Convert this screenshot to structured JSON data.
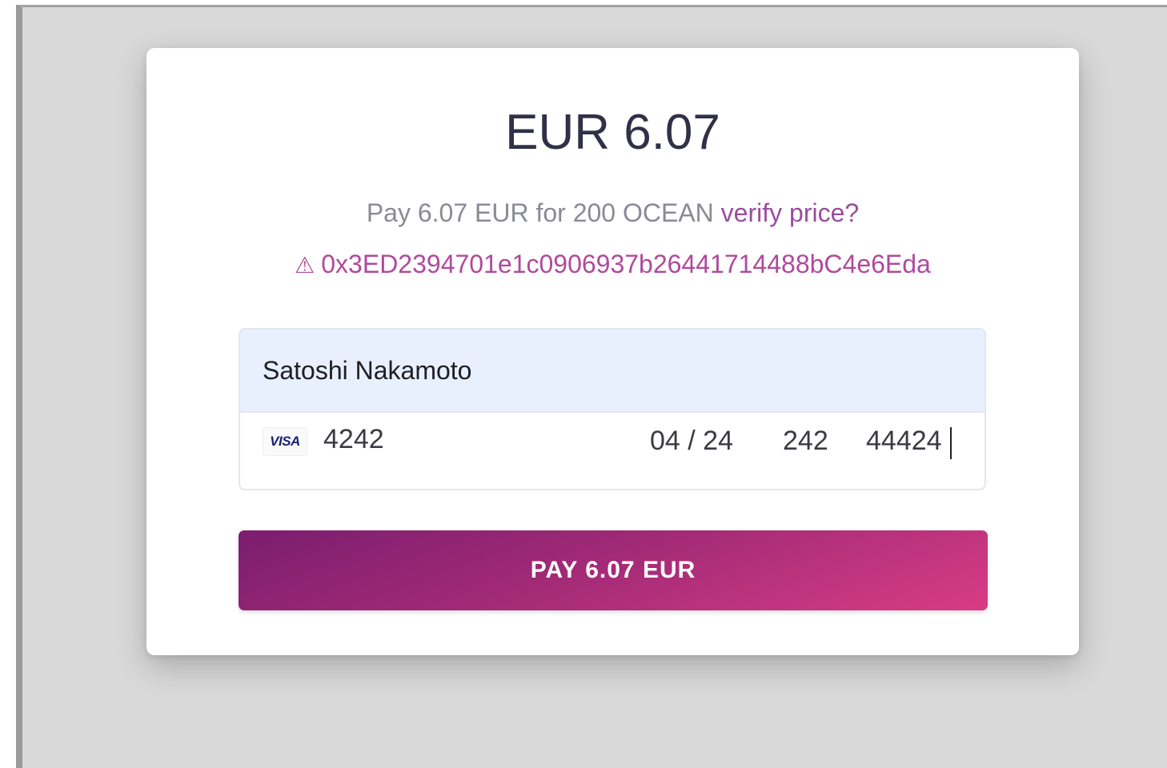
{
  "checkout": {
    "amount_display": "EUR 6.07",
    "pay_text": "Pay 6.07 EUR for 200 OCEAN",
    "verify_link": "verify price?",
    "warning_glyph": "⚠",
    "address": "0x3ED2394701e1c0906937b26441714488bC4e6Eda"
  },
  "card_form": {
    "name_value": "Satoshi Nakamoto",
    "brand_label": "VISA",
    "card_number_value": "4242",
    "expiry_value": "04 / 24",
    "cvc_value": "242",
    "zip_value": "44424"
  },
  "pay_button": {
    "label": "PAY 6.07 EUR"
  },
  "colors": {
    "background": "#d9d9d9",
    "accent_purple": "#9b4c9e",
    "address_pink": "#b1499b",
    "button_gradient_start": "#7b1d6f",
    "button_gradient_end": "#d83c84",
    "name_field_bg": "#e8f0fe"
  }
}
